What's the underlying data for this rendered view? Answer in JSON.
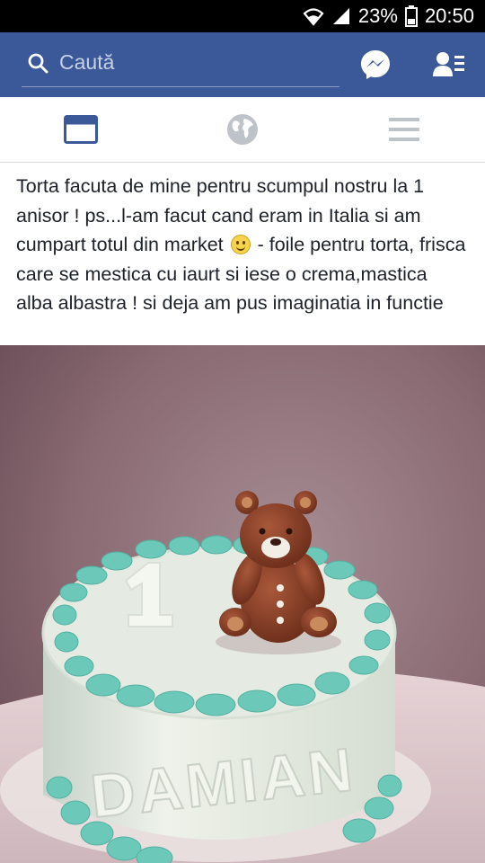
{
  "status_bar": {
    "battery": "23%",
    "time": "20:50"
  },
  "header": {
    "search_placeholder": "Caută"
  },
  "tabs": [
    {
      "name": "news-feed",
      "active": true
    },
    {
      "name": "notifications",
      "active": false
    },
    {
      "name": "menu",
      "active": false
    }
  ],
  "post": {
    "text_before_emoji": "Torta facuta de mine pentru scumpul nostru la 1 anisor ! ps...l-am facut cand eram in Italia si am cumpart totul din market ",
    "emoji": "smiley-emoji",
    "text_after_emoji": " - foile pentru torta, frisca care se mestica cu iaurt si iese o crema,mastica alba albastra  ! si  deja am pus imaginatia in functie"
  },
  "photo": {
    "cake_number": "1",
    "cake_name": "DAMIAN",
    "colors": {
      "background": "#8a6a73",
      "fondant": "#e6ece4",
      "beads": "#6cc9b9",
      "bear": "#8a4028"
    }
  },
  "colors": {
    "brand": "#3b5998",
    "active_tab": "#3b5998",
    "inactive_tab": "#bec3c9"
  }
}
